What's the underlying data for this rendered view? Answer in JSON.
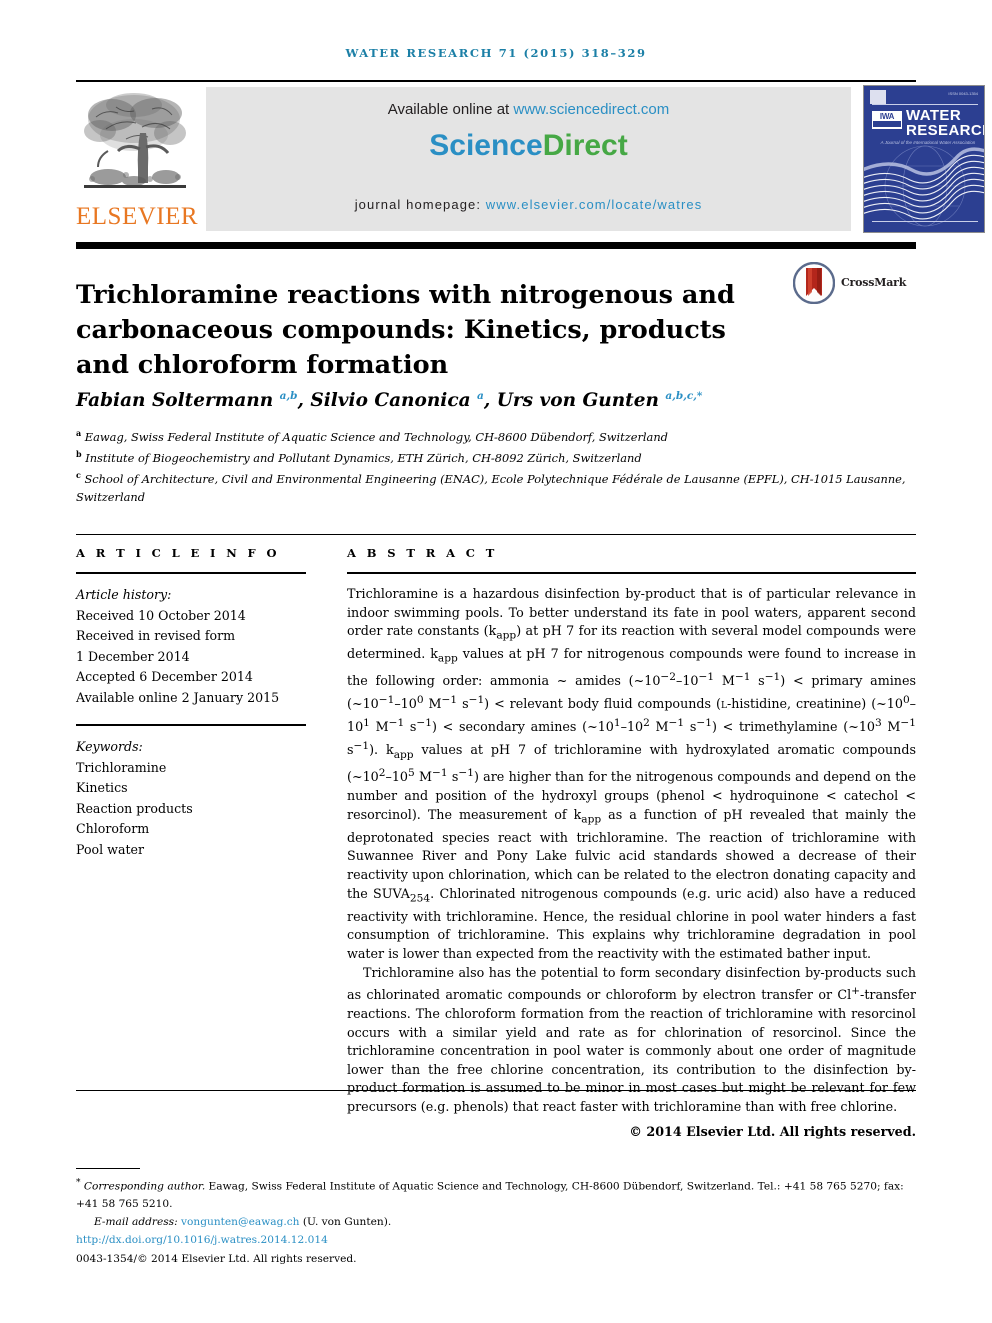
{
  "running_head": "WATER RESEARCH 71 (2015) 318–329",
  "masthead": {
    "publisher_name": "ELSEVIER",
    "available_prefix": "Available online at ",
    "available_url": "www.sciencedirect.com",
    "sciencedirect_part1": "Science",
    "sciencedirect_part2": "Direct",
    "homepage_prefix": "journal homepage: ",
    "homepage_url": "www.elsevier.com/locate/watres",
    "cover": {
      "title_line1": "WATER",
      "title_line2": "RESEARCH",
      "subtitle": "A Journal of the International Water Association",
      "iwa_text": "IWA",
      "issn_text": "ISSN 0043-1354"
    }
  },
  "article": {
    "title": "Trichloramine reactions with nitrogenous and carbonaceous compounds: Kinetics, products and chloroform formation",
    "crossmark_label": "CrossMark",
    "authors": [
      {
        "name": "Fabian Soltermann",
        "sup": "a,b",
        "sep": ", "
      },
      {
        "name": "Silvio Canonica",
        "sup": "a",
        "sep": ", "
      },
      {
        "name": "Urs von Gunten",
        "sup": "a,b,c,*",
        "sep": ""
      }
    ],
    "affiliations": [
      {
        "marker": "a",
        "text": "Eawag, Swiss Federal Institute of Aquatic Science and Technology, CH-8600 Dübendorf, Switzerland"
      },
      {
        "marker": "b",
        "text": "Institute of Biogeochemistry and Pollutant Dynamics, ETH Zürich, CH-8092 Zürich, Switzerland"
      },
      {
        "marker": "c",
        "text": "School of Architecture, Civil and Environmental Engineering (ENAC), Ecole Polytechnique Fédérale de Lausanne (EPFL), CH-1015 Lausanne, Switzerland"
      }
    ]
  },
  "article_info": {
    "heading": "A R T I C L E   I N F O",
    "history_label": "Article history:",
    "history": [
      "Received 10 October 2014",
      "Received in revised form",
      "1 December 2014",
      "Accepted 6 December 2014",
      "Available online 2 January 2015"
    ],
    "keywords_label": "Keywords:",
    "keywords": [
      "Trichloramine",
      "Kinetics",
      "Reaction products",
      "Chloroform",
      "Pool water"
    ]
  },
  "abstract": {
    "heading": "A B S T R A C T",
    "paragraph1_html": "Trichloramine is a hazardous disinfection by-product that is of particular relevance in indoor swimming pools. To better understand its fate in pool waters, apparent second order rate constants (k<sub>app</sub>) at pH 7 for its reaction with several model compounds were determined. k<sub>app</sub> values at pH 7 for nitrogenous compounds were found to increase in the following order: ammonia &#126; amides (&#126;10<sup>−2</sup>–10<sup>−1</sup> M<sup>−1</sup> s<sup>−1</sup>) &lt; primary amines (&#126;10<sup>−1</sup>–10<sup>0</sup> M<sup>−1</sup> s<sup>−1</sup>) &lt; relevant body fluid compounds (<span style=\"font-variant:small-caps\">l</span>-histidine, creatinine) (&#126;10<sup>0</sup>–10<sup>1</sup> M<sup>−1</sup> s<sup>−1</sup>) &lt; secondary amines (&#126;10<sup>1</sup>–10<sup>2</sup> M<sup>−1</sup> s<sup>−1</sup>) &lt; trimethylamine (&#126;10<sup>3</sup> M<sup>−1</sup> s<sup>−1</sup>). k<sub>app</sub> values at pH 7 of trichloramine with hydroxylated aromatic compounds (&#126;10<sup>2</sup>–10<sup>5</sup> M<sup>−1</sup> s<sup>−1</sup>) are higher than for the nitrogenous compounds and depend on the number and position of the hydroxyl groups (phenol &lt; hydroquinone &lt; catechol &lt; resorcinol). The measurement of k<sub>app</sub> as a function of pH revealed that mainly the deprotonated species react with trichloramine. The reaction of trichloramine with Suwannee River and Pony Lake fulvic acid standards showed a decrease of their reactivity upon chlorination, which can be related to the electron donating capacity and the SUVA<sub>254</sub>. Chlorinated nitrogenous compounds (e.g. uric acid) also have a reduced reactivity with trichloramine. Hence, the residual chlorine in pool water hinders a fast consumption of trichloramine. This explains why trichloramine degradation in pool water is lower than expected from the reactivity with the estimated bather input.",
    "paragraph2_html": "Trichloramine also has the potential to form secondary disinfection by-products such as chlorinated aromatic compounds or chloroform by electron transfer or Cl<sup>+</sup>-transfer reactions. The chloroform formation from the reaction of trichloramine with resorcinol occurs with a similar yield and rate as for chlorination of resorcinol. Since the trichloramine concentration in pool water is commonly about one order of magnitude lower than the free chlorine concentration, its contribution to the disinfection by-product formation is assumed to be minor in most cases but might be relevant for few precursors (e.g. phenols) that react faster with trichloramine than with free chlorine.",
    "copyright": "© 2014 Elsevier Ltd. All rights reserved."
  },
  "footer": {
    "corresponding_html": "<span class=\"star\">*</span> <span class=\"it\">Corresponding author.</span> Eawag, Swiss Federal Institute of Aquatic Science and Technology, CH-8600 Dübendorf, Switzerland. Tel.: +41 58 765 5270; fax: +41 58 765 5210.",
    "email_label": "E-mail address:",
    "email": "vongunten@eawag.ch",
    "email_suffix": "(U. von Gunten).",
    "doi": "http://dx.doi.org/10.1016/j.watres.2014.12.014",
    "issn_line": "0043-1354/© 2014 Elsevier Ltd. All rights reserved."
  },
  "colors": {
    "link_blue": "#2a8fc4",
    "running_head_blue": "#1b7fa6",
    "elsevier_orange": "#E87722",
    "sciencedirect_green": "#46a845",
    "cover_blue": "#2c3f91"
  }
}
